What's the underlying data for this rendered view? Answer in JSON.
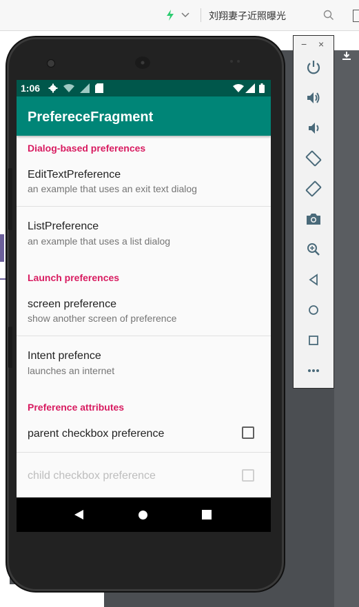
{
  "browser": {
    "search_text": "刘翔妻子近照曝光",
    "icons": [
      "lightning-icon",
      "chevron-down-icon",
      "search-icon",
      "download-icon"
    ]
  },
  "status_bar": {
    "time": "1:06",
    "icons": [
      "settings-icon",
      "wifi-question-icon",
      "signal-icon",
      "sd-card-icon",
      "wifi-icon",
      "signal-full-icon",
      "battery-icon"
    ]
  },
  "app_bar": {
    "title": "PrefereceFragment"
  },
  "categories": {
    "dialog": "Dialog-based preferences",
    "launch": "Launch preferences",
    "attributes": "Preference attributes"
  },
  "prefs": {
    "edittext": {
      "title": "EditTextPreference",
      "summary": "an example that uses an exit text dialog"
    },
    "list": {
      "title": "ListPreference",
      "summary": "an example that uses a list dialog"
    },
    "screen": {
      "title": "screen preference",
      "summary": "show another screen of preference"
    },
    "intent": {
      "title": "Intent prefence",
      "summary": "launches an internet"
    },
    "parent_checkbox": {
      "title": "parent checkbox preference",
      "checked": false
    },
    "child_checkbox": {
      "title": "child checkbox preference",
      "checked": false,
      "enabled": false
    }
  },
  "emulator_toolbar": {
    "minimize": "−",
    "close": "×",
    "buttons": [
      "power-icon",
      "volume-up-icon",
      "volume-down-icon",
      "rotate-left-icon",
      "rotate-right-icon",
      "camera-icon",
      "zoom-icon",
      "back-icon",
      "home-icon",
      "overview-icon",
      "more-icon"
    ]
  },
  "colors": {
    "status_bar": "#00574b",
    "app_bar": "#008577",
    "accent": "#d81b60"
  }
}
